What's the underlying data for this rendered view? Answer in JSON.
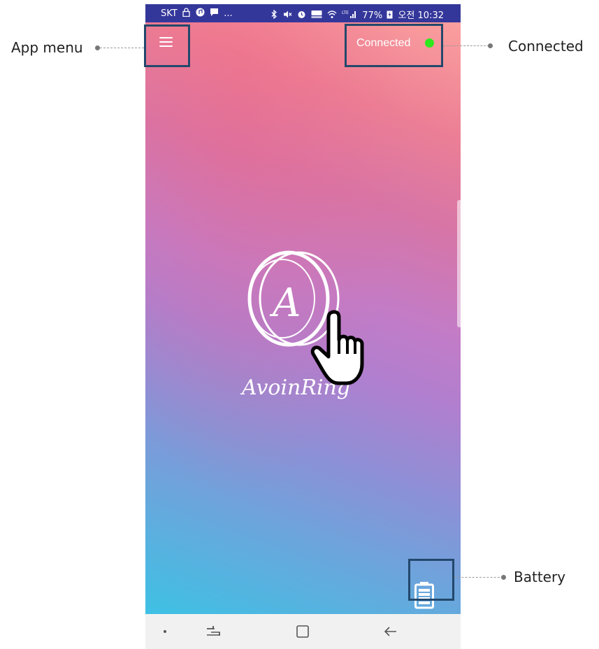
{
  "status_bar": {
    "carrier": "SKT",
    "left_icons": [
      "lock-icon",
      "music-icon",
      "message-icon"
    ],
    "more": "...",
    "right_icons": [
      "bluetooth-icon",
      "mute-icon",
      "alarm-icon",
      "hd-volte-icon",
      "wifi-icon",
      "lte-signal-icon"
    ],
    "battery_percent": "77%",
    "time": "오전 10:32"
  },
  "app": {
    "menu_icon": "hamburger-menu-icon",
    "connection_status": "Connected",
    "connection_color": "#2ee81d",
    "logo_text": "AvoinRing",
    "logo_monogram": "A",
    "battery_icon": "battery-icon"
  },
  "nav_bar": {
    "items": [
      "dot-icon",
      "recent-apps-icon",
      "home-icon",
      "back-icon"
    ]
  },
  "annotations": {
    "app_menu": "App menu",
    "connected": "Connected",
    "battery": "Battery"
  },
  "colors": {
    "status_bar": "#34379a",
    "highlight_border": "#23486c",
    "gradient_top": "#fb9f9e",
    "gradient_bottom": "#3ec1e4"
  }
}
